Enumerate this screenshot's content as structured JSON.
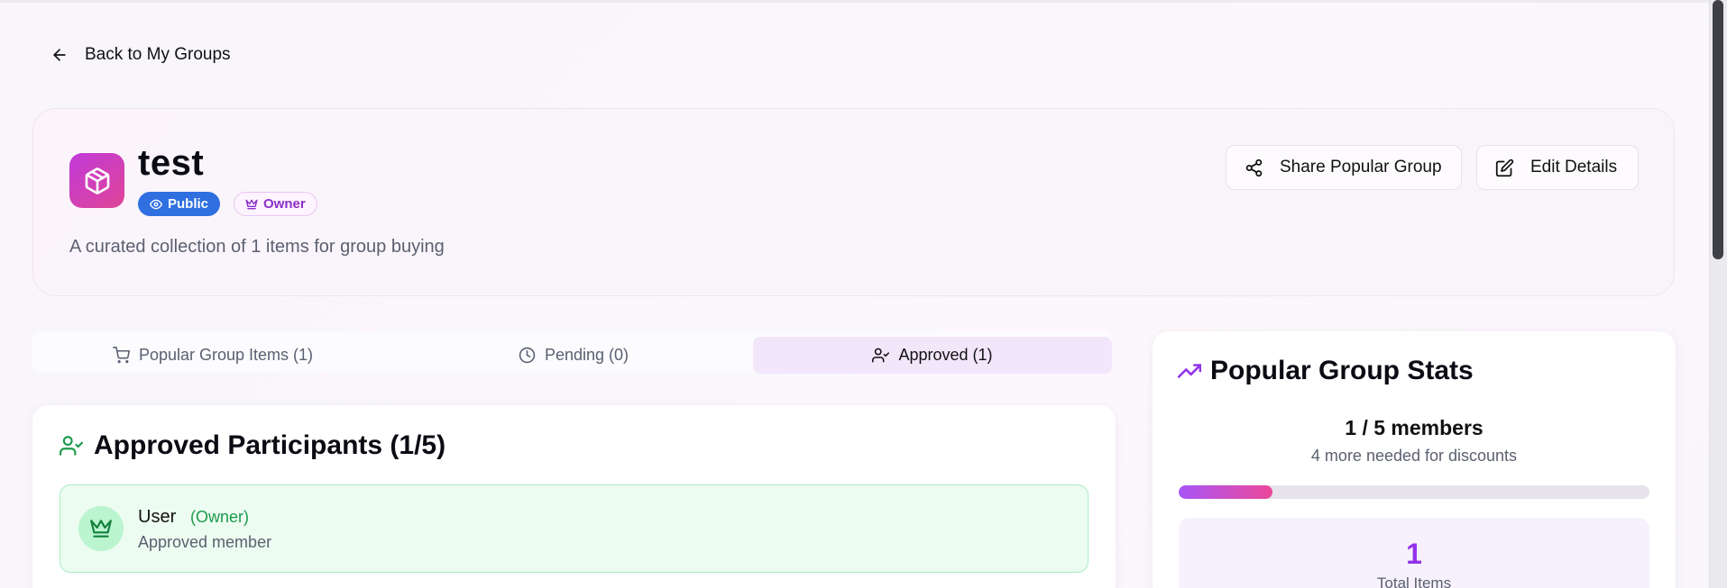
{
  "nav": {
    "back_label": "Back to My Groups"
  },
  "group": {
    "name": "test",
    "visibility_badge": "Public",
    "role_badge": "Owner",
    "description": "A curated collection of 1 items for group buying",
    "share_button": "Share Popular Group",
    "edit_button": "Edit Details"
  },
  "tabs": [
    {
      "label": "Popular Group Items (1)",
      "icon": "cart-icon",
      "active": false
    },
    {
      "label": "Pending (0)",
      "icon": "clock-icon",
      "active": false
    },
    {
      "label": "Approved (1)",
      "icon": "user-check-icon",
      "active": true
    }
  ],
  "participants": {
    "title": "Approved Participants (1/5)",
    "members": [
      {
        "name": "User",
        "role": "(Owner)",
        "status": "Approved member",
        "icon": "crown-icon"
      }
    ]
  },
  "stats": {
    "title": "Popular Group Stats",
    "members_text": "1 / 5 members",
    "needed_text": "4 more needed for discounts",
    "progress_fraction": 0.2,
    "total_items_value": "1",
    "total_items_label": "Total Items"
  },
  "colors": {
    "accent_purple": "#9333ea",
    "public_badge": "#2f6fe0",
    "approved_green": "#1d9a4c",
    "progress_start": "#a855f7",
    "progress_end": "#ec4899"
  }
}
